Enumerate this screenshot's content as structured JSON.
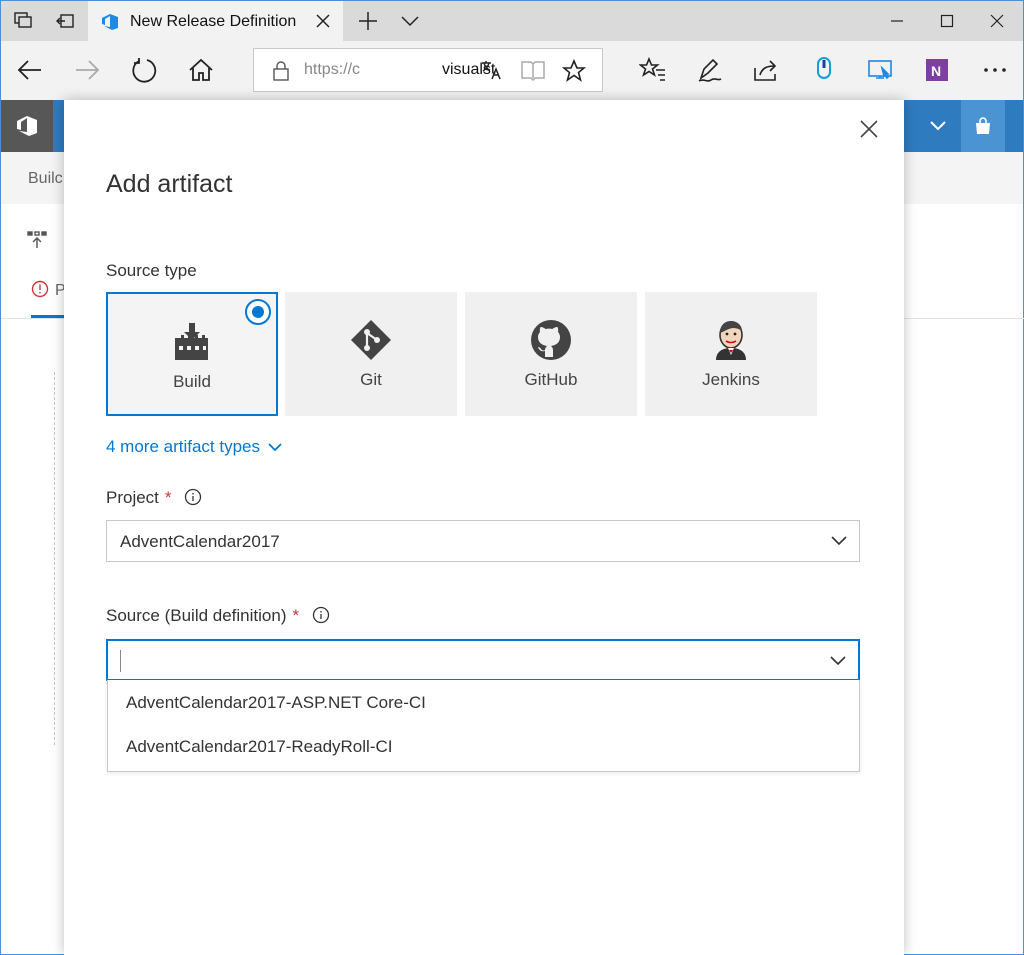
{
  "browser": {
    "tab_title": "New Release Definition",
    "url_prefix": "https://c",
    "url_visible": "visualst"
  },
  "page": {
    "subheader_label": "Builc",
    "tab_label": "P"
  },
  "dialog": {
    "title": "Add artifact",
    "source_type_label": "Source type",
    "source_types": [
      {
        "label": "Build",
        "icon": "build-icon",
        "selected": true
      },
      {
        "label": "Git",
        "icon": "git-icon",
        "selected": false
      },
      {
        "label": "GitHub",
        "icon": "github-icon",
        "selected": false
      },
      {
        "label": "Jenkins",
        "icon": "jenkins-icon",
        "selected": false
      }
    ],
    "more_types_link": "4 more artifact types",
    "project": {
      "label": "Project",
      "required_mark": "*",
      "value": "AdventCalendar2017"
    },
    "source": {
      "label": "Source (Build definition)",
      "required_mark": "*",
      "value": ""
    },
    "source_options": [
      "AdventCalendar2017-ASP.NET Core-CI",
      "AdventCalendar2017-ReadyRoll-CI"
    ]
  },
  "colors": {
    "accent": "#0078d4",
    "header_blue": "#2f7bc0",
    "required": "#d13438"
  }
}
